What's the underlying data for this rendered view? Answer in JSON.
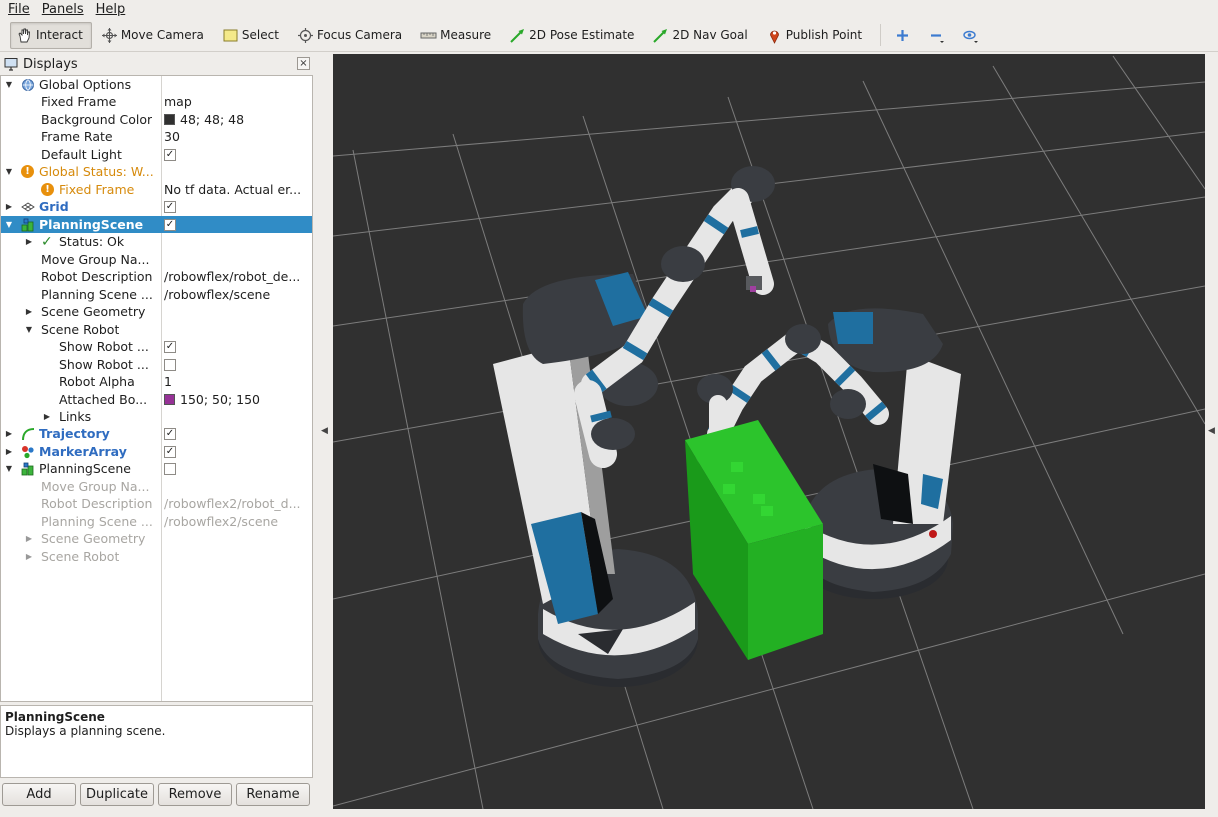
{
  "menu": [
    "File",
    "Panels",
    "Help"
  ],
  "toolbar": {
    "tools": [
      {
        "label": "Interact",
        "icon": "interact-hand-icon",
        "active": true
      },
      {
        "label": "Move Camera",
        "icon": "move-camera-icon"
      },
      {
        "label": "Select",
        "icon": "select-box-icon"
      },
      {
        "label": "Focus Camera",
        "icon": "focus-camera-icon"
      },
      {
        "label": "Measure",
        "icon": "measure-ruler-icon"
      },
      {
        "label": "2D Pose Estimate",
        "icon": "pose-estimate-arrow-icon"
      },
      {
        "label": "2D Nav Goal",
        "icon": "nav-goal-arrow-icon"
      },
      {
        "label": "Publish Point",
        "icon": "publish-point-pin-icon"
      }
    ],
    "extra_icons": [
      "add-tool-icon",
      "remove-tool-icon",
      "view-options-icon"
    ]
  },
  "displays": {
    "title": "Displays",
    "close": "×",
    "tree": [
      {
        "label": "Global Options",
        "value": "",
        "icon": "globe-options-icon"
      },
      {
        "label": "Fixed Frame",
        "value": "map"
      },
      {
        "label": "Background Color",
        "value": "48; 48; 48",
        "swatch": "#303030"
      },
      {
        "label": "Frame Rate",
        "value": "30"
      },
      {
        "label": "Default Light",
        "value": "",
        "checked": true
      },
      {
        "label": "Global Status: W...",
        "value": "",
        "icon": "warning-icon"
      },
      {
        "label": "Fixed Frame",
        "value": "No tf data.  Actual er...",
        "icon": "warning-icon"
      },
      {
        "label": "Grid",
        "value": "",
        "checked": true,
        "icon": "grid-icon"
      },
      {
        "label": "PlanningScene",
        "value": "",
        "checked": true,
        "icon": "planning-scene-icon",
        "selected": true
      },
      {
        "label": "Status: Ok",
        "value": "",
        "icon": "checkmark-icon"
      },
      {
        "label": "Move Group Na...",
        "value": ""
      },
      {
        "label": "Robot Description",
        "value": "/robowflex/robot_de..."
      },
      {
        "label": "Planning Scene ...",
        "value": "/robowflex/scene"
      },
      {
        "label": "Scene Geometry",
        "value": ""
      },
      {
        "label": "Scene Robot",
        "value": ""
      },
      {
        "label": "Show Robot ...",
        "value": "",
        "checked": true
      },
      {
        "label": "Show Robot ...",
        "value": "",
        "checked": false
      },
      {
        "label": "Robot Alpha",
        "value": "1"
      },
      {
        "label": "Attached Bo...",
        "value": "150; 50; 150",
        "swatch": "#963296"
      },
      {
        "label": "Links",
        "value": ""
      },
      {
        "label": "Trajectory",
        "value": "",
        "checked": true,
        "icon": "trajectory-icon"
      },
      {
        "label": "MarkerArray",
        "value": "",
        "checked": true,
        "icon": "marker-array-icon"
      },
      {
        "label": "PlanningScene",
        "value": "",
        "checked": false,
        "icon": "planning-scene-icon"
      },
      {
        "label": "Move Group Na...",
        "value": ""
      },
      {
        "label": "Robot Description",
        "value": "/robowflex2/robot_d..."
      },
      {
        "label": "Planning Scene ...",
        "value": "/robowflex2/scene"
      },
      {
        "label": "Scene Geometry",
        "value": ""
      },
      {
        "label": "Scene Robot",
        "value": ""
      }
    ],
    "description_title": "PlanningScene",
    "description_text": "Displays a planning scene.",
    "buttons": [
      "Add",
      "Duplicate",
      "Remove",
      "Rename"
    ]
  },
  "colors": {
    "selection": "#308cc6",
    "viewport_background": "#303030",
    "grid_lines": "#a0a0a0",
    "box_green": "#22b022",
    "robot_blue": "#1f6fa0",
    "robot_white": "#e6e6e6",
    "robot_dark": "#3a3d42",
    "warning": "#e8900c"
  }
}
